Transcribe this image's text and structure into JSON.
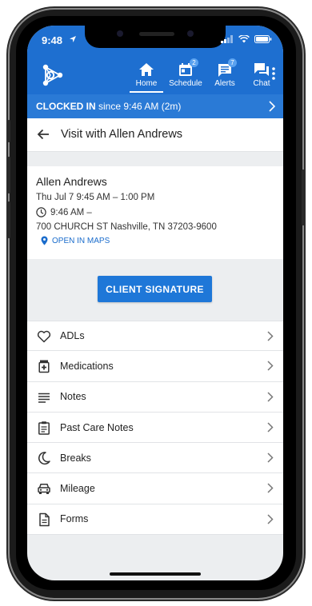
{
  "status_bar": {
    "time": "9:48"
  },
  "nav": {
    "items": [
      {
        "label": "Home",
        "badge": ""
      },
      {
        "label": "Schedule",
        "badge": "2"
      },
      {
        "label": "Alerts",
        "badge": "7"
      },
      {
        "label": "Chat",
        "badge": ""
      }
    ]
  },
  "clocked": {
    "status": "CLOCKED IN",
    "since": " since 9:46 AM (2m)"
  },
  "page": {
    "title": "Visit with Allen Andrews"
  },
  "visit": {
    "client_name": "Allen Andrews",
    "schedule": "Thu Jul 7 9:45 AM – 1:00 PM",
    "clock_in": "9:46 AM –",
    "address": "700 CHURCH ST Nashville, TN 37203-9600",
    "maps_link": "OPEN IN MAPS"
  },
  "actions": {
    "signature_label": "CLIENT SIGNATURE"
  },
  "menu": [
    {
      "label": "ADLs",
      "icon": "heart-icon"
    },
    {
      "label": "Medications",
      "icon": "medication-icon"
    },
    {
      "label": "Notes",
      "icon": "notes-icon"
    },
    {
      "label": "Past Care Notes",
      "icon": "clipboard-icon"
    },
    {
      "label": "Breaks",
      "icon": "moon-icon"
    },
    {
      "label": "Mileage",
      "icon": "car-icon"
    },
    {
      "label": "Forms",
      "icon": "document-icon"
    }
  ],
  "colors": {
    "brand": "#1e6fd0",
    "button": "#1e77d8",
    "link": "#1a6ccc"
  }
}
